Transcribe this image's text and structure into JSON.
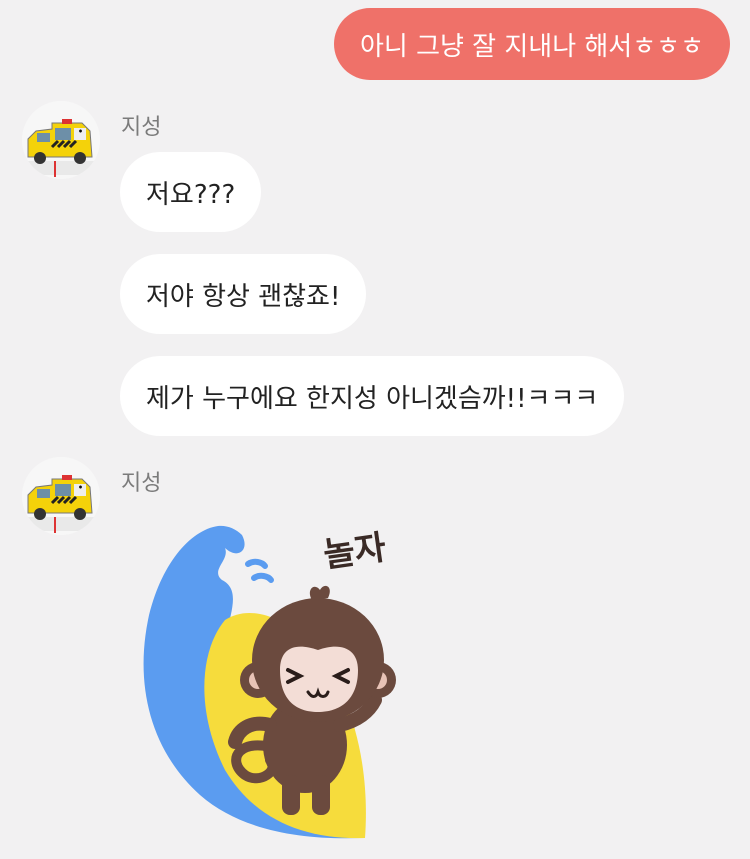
{
  "outgoing": {
    "text": "아니 그냥 잘 지내나 해서ㅎㅎㅎ",
    "color": "#ef7169"
  },
  "groups": [
    {
      "sender": "지성",
      "avatar_icon": "ambulance-toy-icon",
      "messages": [
        "저요???",
        "저야 항상 괜찮죠!",
        "제가 누구에요 한지성 아니겠슴까!!ㅋㅋㅋ"
      ]
    },
    {
      "sender": "지성",
      "avatar_icon": "ambulance-toy-icon",
      "sticker": {
        "icon": "surfing-monkey-sticker",
        "text": "놀자"
      }
    }
  ],
  "colors": {
    "background": "#f2f1f2",
    "incoming_bubble": "#ffffff",
    "sender_name": "#7b7b7b"
  }
}
